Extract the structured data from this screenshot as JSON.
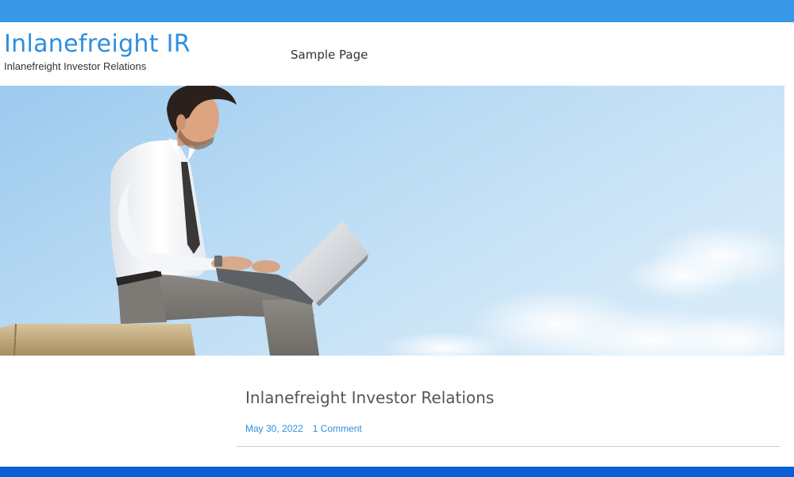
{
  "header": {
    "site_title": "Inlanefreight IR",
    "tagline": "Inlanefreight Investor Relations",
    "nav": [
      {
        "label": "Sample Page"
      }
    ]
  },
  "hero": {
    "image": "man-with-laptop-sitting-on-wall-under-blue-sky"
  },
  "post": {
    "title": "Inlanefreight Investor Relations",
    "date": "May 30, 2022",
    "comments": "1 Comment"
  },
  "colors": {
    "top_bar": "#3897e6",
    "bottom_bar": "#0a5fd6",
    "link": "#2e8ede",
    "heading": "#555555"
  }
}
